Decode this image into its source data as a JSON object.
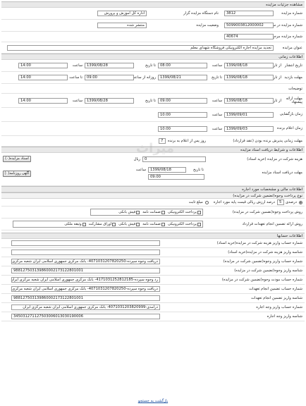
{
  "page_title": "مشاهده جزئیات مزایده",
  "top": {
    "auction_no_label": "شماره مزایده",
    "auction_no_value": "3812",
    "organizer_label": "نام دستگاه مزایده گزار",
    "organizer_value": "اداره کل آموزش و پرورش",
    "setad_no_label": "شماره مزایده در سامانه ستاد",
    "setad_no_value": "5099003812000002",
    "status_label": "وضعیت مزایده",
    "status_value": "منتشر شده",
    "ref_no_label": "شماره مزایده مرجع",
    "ref_no_value": "40674",
    "title_label": "عنوان مزایده",
    "title_value": "تجدید مزایده اجاره الکترونیکی فروشگاه شهدای معلم"
  },
  "timing": {
    "section": "اطلاعات زمانی",
    "from_label": "از تاریخ",
    "to_label": "تا تاریخ",
    "hour_label": "ساعت",
    "publish": {
      "label": "تاریخ انتشار",
      "from_date": "1399/08/18",
      "from_time": "08:00",
      "to_date": "1399/08/28",
      "to_time": "14:00"
    },
    "visit": {
      "label": "مهلت بازدید",
      "from_date": "1399/08/18",
      "from_time": "09:00",
      "to_label": "روزانه از ساعت",
      "to_date": "1399/08/21",
      "mid_to_label": "تا ساعت",
      "to_time": "14:00"
    },
    "notes_label": "توضیحات",
    "offer": {
      "label": "مهلت ارائه پیشنهاد",
      "from_date": "1399/08/18",
      "from_time": "09:00",
      "to_date": "1399/08/28",
      "to_time": "14:00"
    },
    "opening": {
      "label": "زمان بازگشایی",
      "date": "1399/09/01",
      "time": "10:00"
    },
    "winner": {
      "label": "زمان اعلام برنده",
      "date": "1399/09/03",
      "time": "10:00"
    }
  },
  "contract": {
    "label": "مهلت زمانی پذیرش برنده بودن (عقد قرارداد)",
    "days": "7",
    "suffix": "روز پس از اعلام به برنده"
  },
  "docs": {
    "section": "اطلاعات و شرایط دریافت اسناد مزایده",
    "fee_label": "هزینه شرکت در مزایده (خرید اسناد)",
    "fee_value": "0",
    "rial": "ریال",
    "docs_button": "اسناد مزایده(۰)",
    "deadline_label": "مهلت دریافت اسناد مزایده",
    "to_date_label": "تا تاریخ",
    "deadline_date": "1399/08/18",
    "hour_label": "ساعت",
    "deadline_time": "09:00",
    "news_button": "آگهی روزنامه(۰)"
  },
  "finance": {
    "section": "اطلاعات مالی و مشخصات مورد اجاره",
    "guarantee_section": "نوع پرداخت وجوه(تضمین شرکت در مزایده)",
    "percent_label": "درصدی",
    "percent_value": "5",
    "percent_text": "درصد ارزش ریالی قیمت پایه مورد اجاره",
    "fixed_label": "مبلغ ثابت",
    "method_label": "روش پرداخت وجوه(تضمین شرکت در مزایده)",
    "methods": [
      "پرداخت الکترونیکی",
      "ضمانت نامه",
      "فیش بانکی"
    ],
    "contract_method_label": "روش ارائه تضمین انجام تعهدات قرارداد",
    "contract_methods": [
      "پرداخت الکترونیکی",
      "ضمانت نامه",
      "فیش بانکی",
      "اوراق مشارکت",
      "وثیقه ملکی"
    ]
  },
  "accounts": {
    "section": "اطلاعات حسابها",
    "rows": [
      {
        "label": "شماره حساب واریز هزینه شرکت در مزایده(خرید اسناد)",
        "value": ""
      },
      {
        "label": "شناسه واریز هزینه شرکت در مزایده(خرید اسناد)",
        "value": ""
      },
      {
        "label": "شماره حساب واریز وجوه(تضمین شرکت در مزایده)",
        "value": "دریافت وجوه سپرده-4071031207820250- بانک مرکزی جمهوری اسلامی ایران شعبه مرکزی ایران"
      },
      {
        "label": "شناسه واریز وجوه(تضمین شرکت در مزایده)",
        "value": "988127503139860002173122801001"
      },
      {
        "label": "شماره حساب مودت وجوه(تضمین شرکت در مزایده)",
        "value": "رد وجوه سپرده-4171031252812185- بانک مرکزی جمهوری اسلامی ایران شعبه مرکزی ایران"
      },
      {
        "label": "شماره حساب تضمین انجام تعهدات",
        "value": "دریافت وجوه سپرده-4071031207820250- بانک مرکزی جمهوری اسلامی ایران شعبه مرکزی ایران"
      },
      {
        "label": "شناسه واریز تضمین انجام تعهدات",
        "value": "988127503139860002173122801001"
      },
      {
        "label": "شماره حساب واریز وجه اجاره",
        "value": "درآمدی-4071031203820999- بانک مرکزی جمهوری اسلامی ایران شعبه مرکزی ایران"
      },
      {
        "label": "شناسه واریز وجه اجاره",
        "value": "345031271127503006013030190006"
      }
    ]
  },
  "watermark": "میراث",
  "footer_link": "بازگشت به جستجو"
}
